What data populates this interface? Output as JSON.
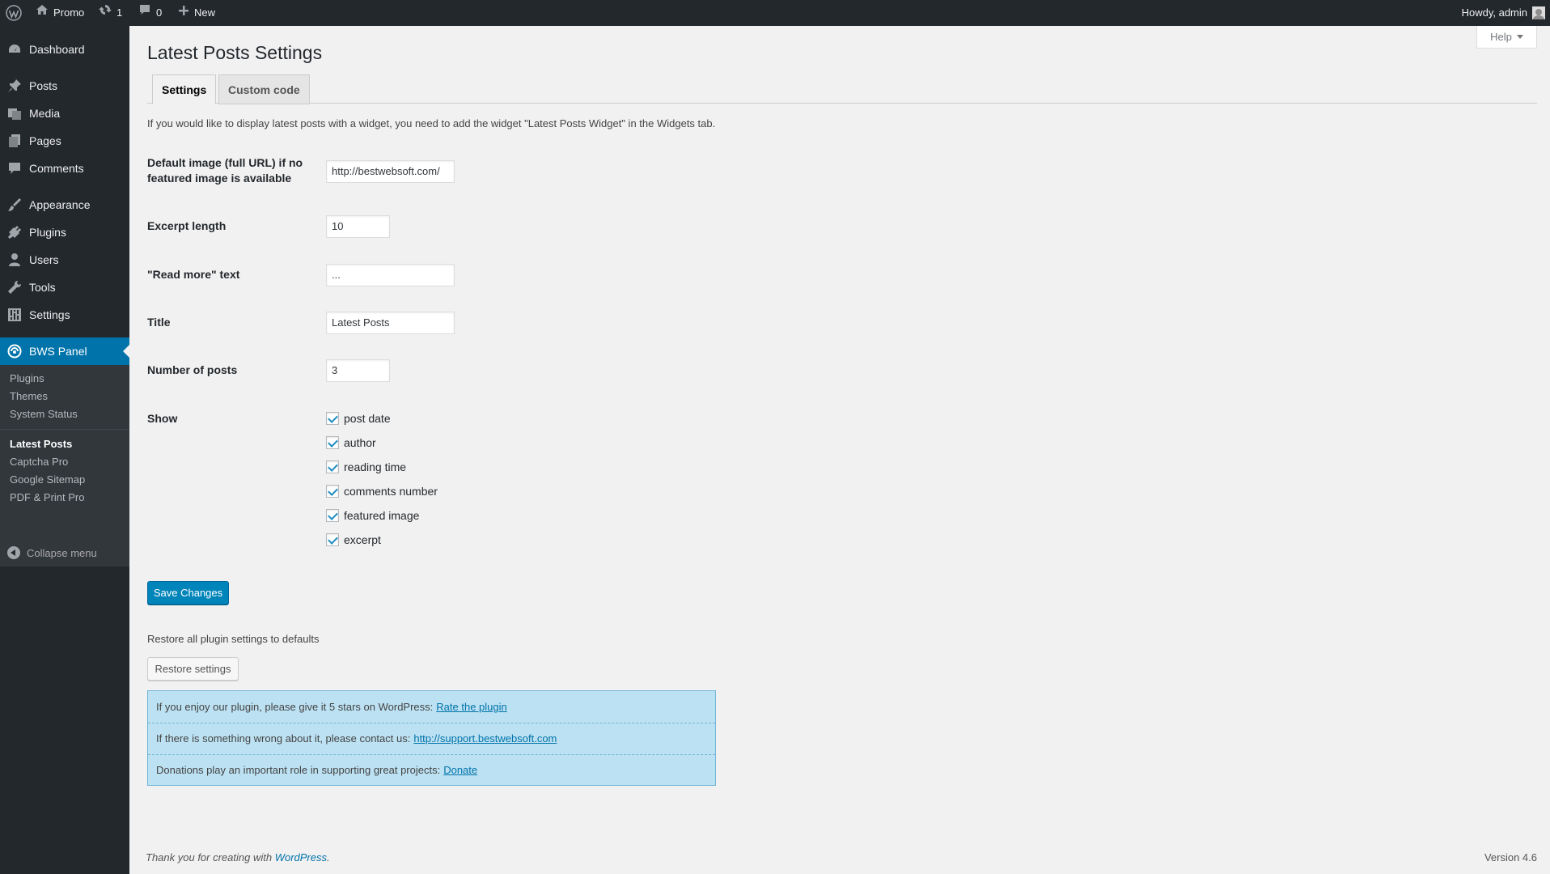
{
  "adminbar": {
    "site_name": "Promo",
    "updates_count": "1",
    "comments_count": "0",
    "new_label": "New",
    "greeting": "Howdy, admin"
  },
  "sidebar": {
    "items": [
      {
        "label": "Dashboard",
        "icon": "dashboard-icon"
      },
      {
        "label": "Posts",
        "icon": "pin-icon"
      },
      {
        "label": "Media",
        "icon": "media-icon"
      },
      {
        "label": "Pages",
        "icon": "pages-icon"
      },
      {
        "label": "Comments",
        "icon": "comment-icon"
      },
      {
        "label": "Appearance",
        "icon": "brush-icon"
      },
      {
        "label": "Plugins",
        "icon": "plug-icon"
      },
      {
        "label": "Users",
        "icon": "user-icon"
      },
      {
        "label": "Tools",
        "icon": "wrench-icon"
      },
      {
        "label": "Settings",
        "icon": "sliders-icon"
      },
      {
        "label": "BWS Panel",
        "icon": "bws-icon"
      }
    ],
    "submenu": [
      "Plugins",
      "Themes",
      "System Status",
      "Latest Posts",
      "Captcha Pro",
      "Google Sitemap",
      "PDF & Print Pro"
    ],
    "collapse_label": "Collapse menu"
  },
  "main": {
    "help_label": "Help",
    "page_title": "Latest Posts Settings",
    "tabs": [
      "Settings",
      "Custom code"
    ],
    "notice": "If you would like to display latest posts with a widget, you need to add the widget \"Latest Posts Widget\" in the Widgets tab.",
    "fields": {
      "default_image_label": "Default image (full URL) if no featured image is available",
      "default_image_value": "http://bestwebsoft.com/",
      "excerpt_length_label": "Excerpt length",
      "excerpt_length_value": "10",
      "read_more_label": "\"Read more\" text",
      "read_more_value": "...",
      "title_label": "Title",
      "title_value": "Latest Posts",
      "num_posts_label": "Number of posts",
      "num_posts_value": "3",
      "show_label": "Show"
    },
    "show_options": [
      "post date",
      "author",
      "reading time",
      "comments number",
      "featured image",
      "excerpt"
    ],
    "save_label": "Save Changes",
    "restore_text": "Restore all plugin settings to defaults",
    "restore_label": "Restore settings",
    "info": {
      "rate_text": "If you enjoy our plugin, please give it 5 stars on WordPress:",
      "rate_link": "Rate the plugin",
      "support_text": "If there is something wrong about it, please contact us:",
      "support_link": "http://support.bestwebsoft.com",
      "donate_text": "Donations play an important role in supporting great projects:",
      "donate_link": "Donate"
    }
  },
  "footer": {
    "thanks_text": "Thank you for creating with",
    "wp_link": "WordPress",
    "thanks_end": ".",
    "version": "Version 4.6"
  },
  "colors": {
    "adminbar_bg": "#23282d",
    "accent": "#0073aa",
    "primary_button": "#0085ba",
    "info_box_bg": "#bce1f2"
  }
}
